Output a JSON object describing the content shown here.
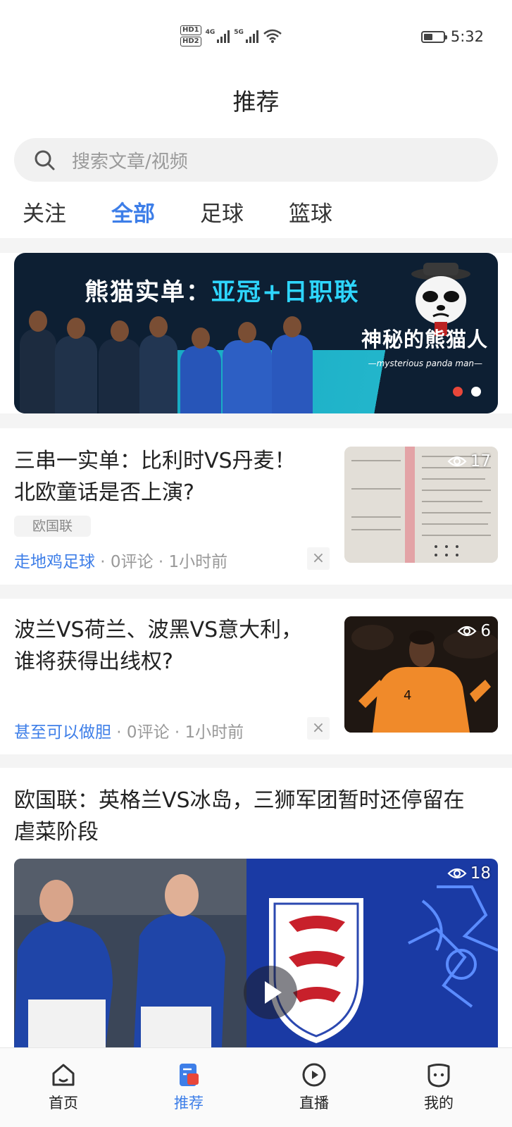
{
  "status_bar": {
    "hd1": "HD1",
    "hd2": "HD2",
    "net1": "4G",
    "net2": "5G",
    "time": "5:32",
    "battery_level": 0.45
  },
  "header": {
    "title": "推荐",
    "search_placeholder": "搜索文章/视频"
  },
  "tabs": [
    {
      "label": "关注",
      "active": false
    },
    {
      "label": "全部",
      "active": true
    },
    {
      "label": "足球",
      "active": false
    },
    {
      "label": "篮球",
      "active": false
    }
  ],
  "banner": {
    "title_prefix": "熊猫实单：",
    "title_highlight": "亚冠+日职联",
    "script_text": "神秘的熊猫人",
    "sub_text": "—mysterious panda man—",
    "dots": 2,
    "active_dot": 0
  },
  "articles": [
    {
      "title_line1": "三串一实单：比利时VS丹麦！",
      "title_line2": "北欧童话是否上演?",
      "tag": "欧国联",
      "author": "走地鸡足球",
      "comments": " · 0评论 · ",
      "time": "1小时前",
      "views": "17",
      "close": "×"
    },
    {
      "title_line1": "波兰VS荷兰、波黑VS意大利，",
      "title_line2": "谁将获得出线权?",
      "author": "甚至可以做胆",
      "comments": " · 0评论 · ",
      "time": "1小时前",
      "views": "6",
      "close": "×"
    },
    {
      "title_line1": "欧国联：英格兰VS冰岛，三狮军团暂时还停留在",
      "title_line2": "虐菜阶段",
      "views": "18"
    }
  ],
  "bottom_nav": [
    {
      "label": "首页",
      "icon": "home-icon",
      "active": false
    },
    {
      "label": "推荐",
      "icon": "recommend-icon",
      "active": true
    },
    {
      "label": "直播",
      "icon": "live-icon",
      "active": false
    },
    {
      "label": "我的",
      "icon": "profile-icon",
      "active": false
    }
  ],
  "colors": {
    "accent": "#3d7ee8",
    "badge_red": "#e8473a"
  }
}
